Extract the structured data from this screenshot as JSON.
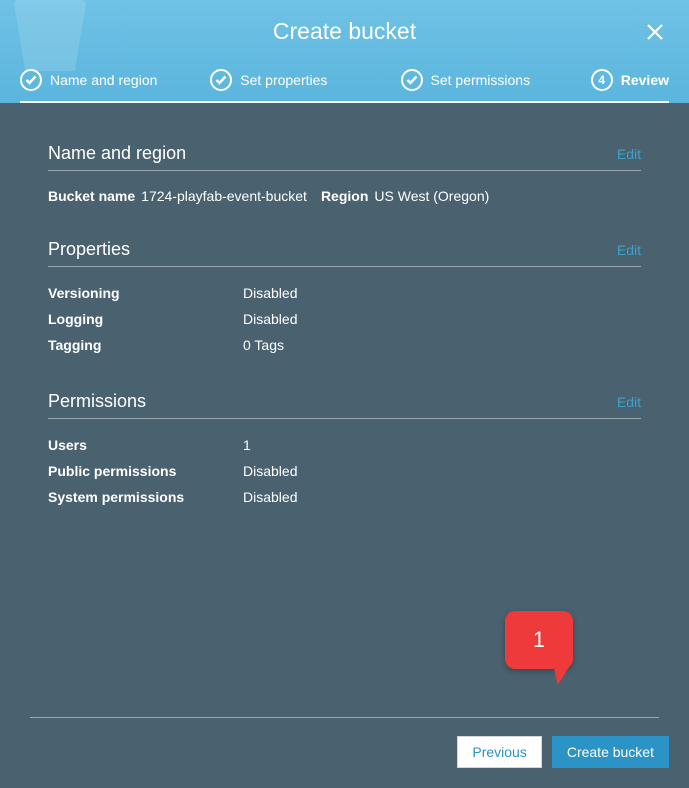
{
  "title": "Create bucket",
  "steps": [
    {
      "label": "Name and region",
      "completed": true
    },
    {
      "label": "Set properties",
      "completed": true
    },
    {
      "label": "Set permissions",
      "completed": true
    },
    {
      "label": "Review",
      "num": "4",
      "active": true
    }
  ],
  "sections": {
    "name_region": {
      "title": "Name and region",
      "edit": "Edit",
      "bucket_name_label": "Bucket name",
      "bucket_name_value": "1724-playfab-event-bucket",
      "region_label": "Region",
      "region_value": "US West (Oregon)"
    },
    "properties": {
      "title": "Properties",
      "edit": "Edit",
      "rows": [
        {
          "k": "Versioning",
          "v": "Disabled"
        },
        {
          "k": "Logging",
          "v": "Disabled"
        },
        {
          "k": "Tagging",
          "v": "0 Tags"
        }
      ]
    },
    "permissions": {
      "title": "Permissions",
      "edit": "Edit",
      "rows": [
        {
          "k": "Users",
          "v": "1"
        },
        {
          "k": "Public permissions",
          "v": "Disabled"
        },
        {
          "k": "System permissions",
          "v": "Disabled"
        }
      ]
    }
  },
  "footer": {
    "previous": "Previous",
    "create": "Create bucket"
  },
  "callout": "1"
}
